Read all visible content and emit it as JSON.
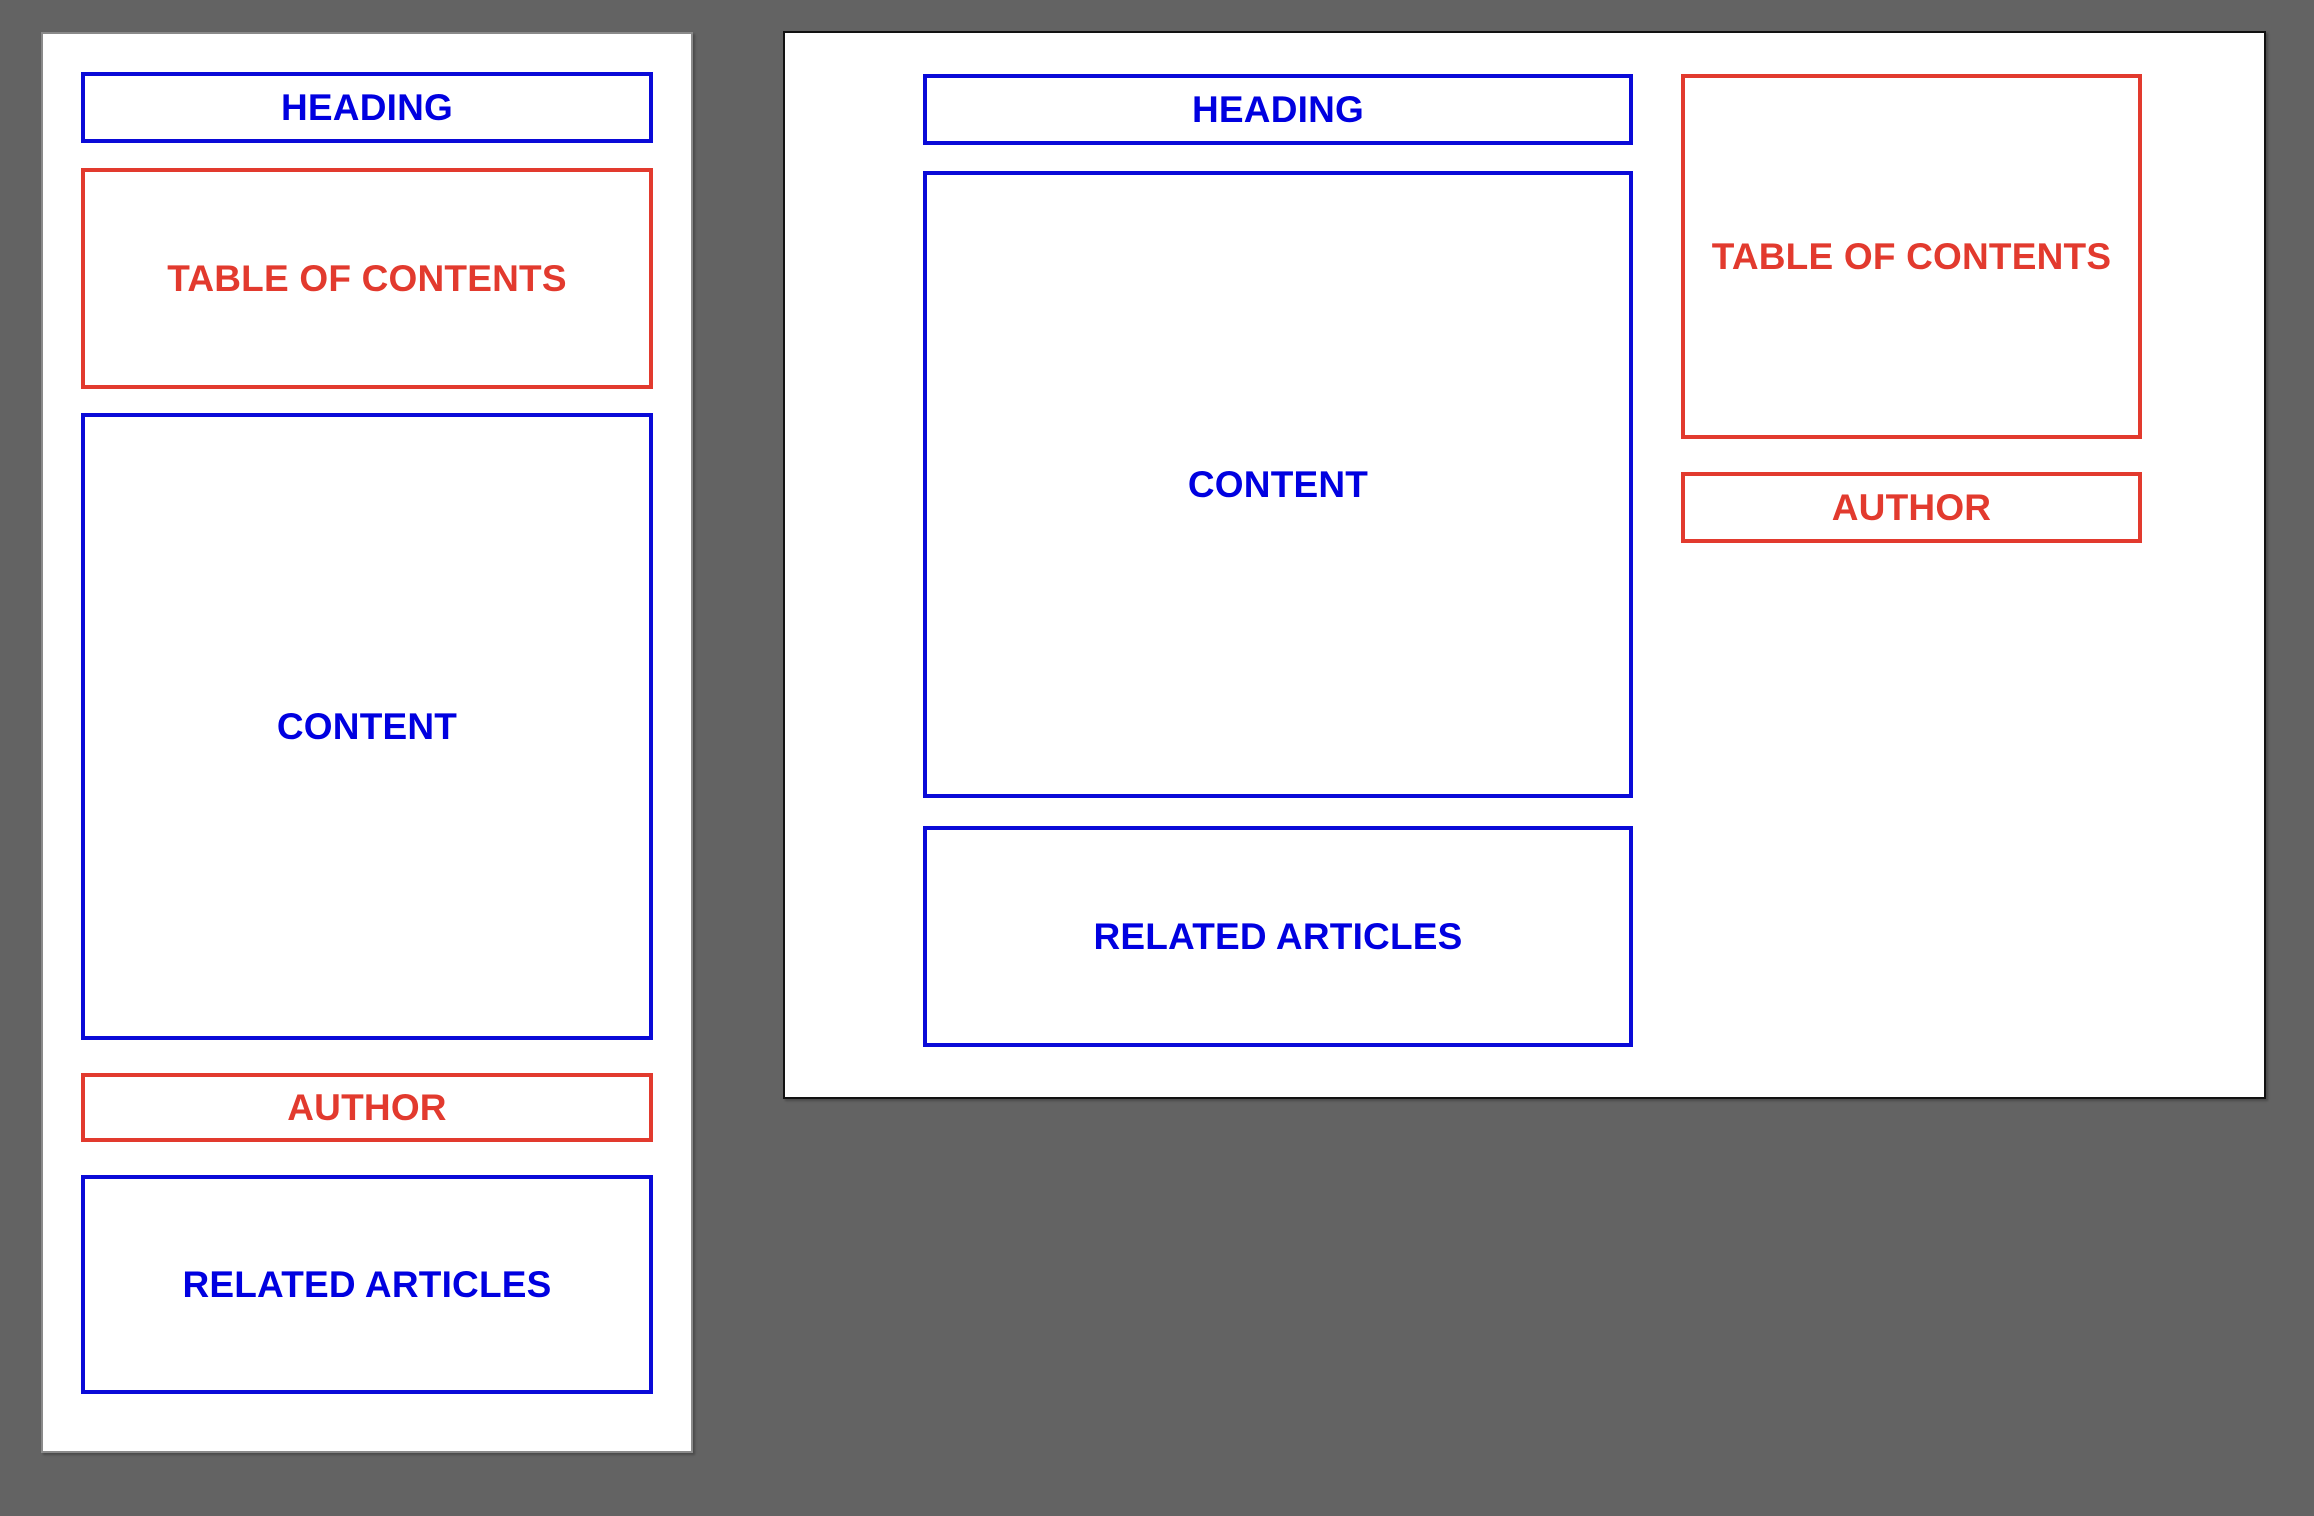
{
  "colors": {
    "background": "#636363",
    "primary_block": "#0000e0",
    "secondary_block": "#e23a2e",
    "panel": "#ffffff"
  },
  "mobile_layout": {
    "blocks": [
      {
        "label": "HEADING",
        "type": "primary"
      },
      {
        "label": "TABLE OF CONTENTS",
        "type": "secondary"
      },
      {
        "label": "CONTENT",
        "type": "primary"
      },
      {
        "label": "AUTHOR",
        "type": "secondary"
      },
      {
        "label": "RELATED ARTICLES",
        "type": "primary"
      }
    ]
  },
  "desktop_layout": {
    "main_column": [
      {
        "label": "HEADING",
        "type": "primary"
      },
      {
        "label": "CONTENT",
        "type": "primary"
      },
      {
        "label": "RELATED ARTICLES",
        "type": "primary"
      }
    ],
    "sidebar": [
      {
        "label": "TABLE OF CONTENTS",
        "type": "secondary"
      },
      {
        "label": "AUTHOR",
        "type": "secondary"
      }
    ]
  }
}
